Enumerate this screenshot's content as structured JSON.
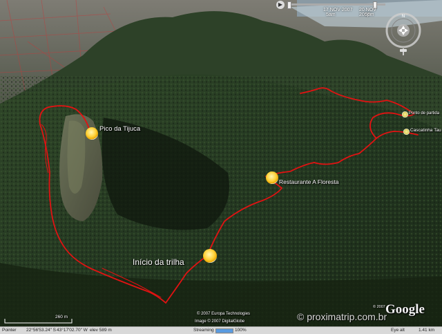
{
  "colors": {
    "trail": "#e21212",
    "forest_dark": "#1b2a17",
    "forest_mid": "#2f4527",
    "sky_city": "#6f6f69"
  },
  "placemarks": [
    {
      "name": "Pico da Tijuca",
      "size": "big"
    },
    {
      "name": "Restaurante A Floresta",
      "size": "big"
    },
    {
      "name": "Início da trilha",
      "size": "big"
    },
    {
      "name": "Ponto de partida",
      "size": "small"
    },
    {
      "name": "Cascatinha Tau",
      "size": "small"
    }
  ],
  "time_slider": {
    "start_date": "17 NOV 2007",
    "start_time": "5am",
    "end_date": "20 NOV 2007",
    "end_time": "5pm"
  },
  "scale_bar": {
    "label": "260 m"
  },
  "credits": [
    "© 2007 Europa Technologies",
    "Image © 2007 DigitalGlobe"
  ],
  "copyright_small": "© 2007",
  "logo": "Google",
  "watermark": "© proximatrip.com.br",
  "status": {
    "pointer": "Pointer",
    "lat": "22°56'53.24\" S",
    "lon": "43°17'02.70\" W",
    "elev": "elev  589 m",
    "streaming": "Streaming",
    "streaming_pct": "100%",
    "streaming_fraction": 1.0,
    "eye_alt": "Eye alt",
    "eye_alt_val": "1.41 km"
  },
  "icons": {
    "nav_compass": "compass-ring-icon",
    "nav_look": "look-joystick-icon",
    "play": "play-icon"
  }
}
